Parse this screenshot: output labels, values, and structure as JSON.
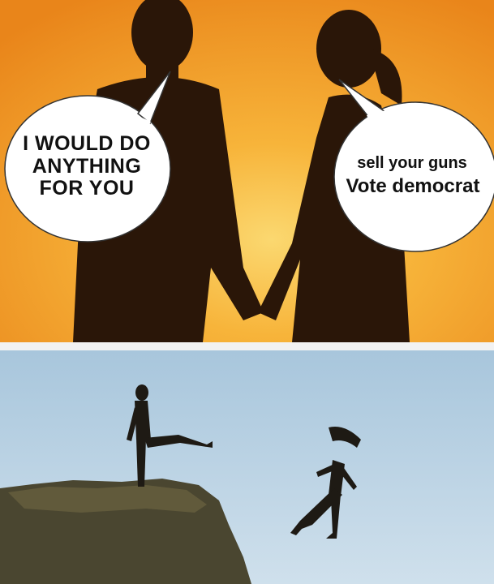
{
  "top_panel": {
    "man_speech": "I WOULD DO ANYTHING FOR YOU",
    "woman_speech_line1": "sell your guns",
    "woman_speech_line2": "Vote democrat"
  },
  "colors": {
    "sunset_orange": "#f4a21c",
    "sunset_glow": "#f9c850",
    "silhouette": "#2a1608",
    "sky_blue": "#b9d4e6",
    "cliff": "#4a4630"
  }
}
